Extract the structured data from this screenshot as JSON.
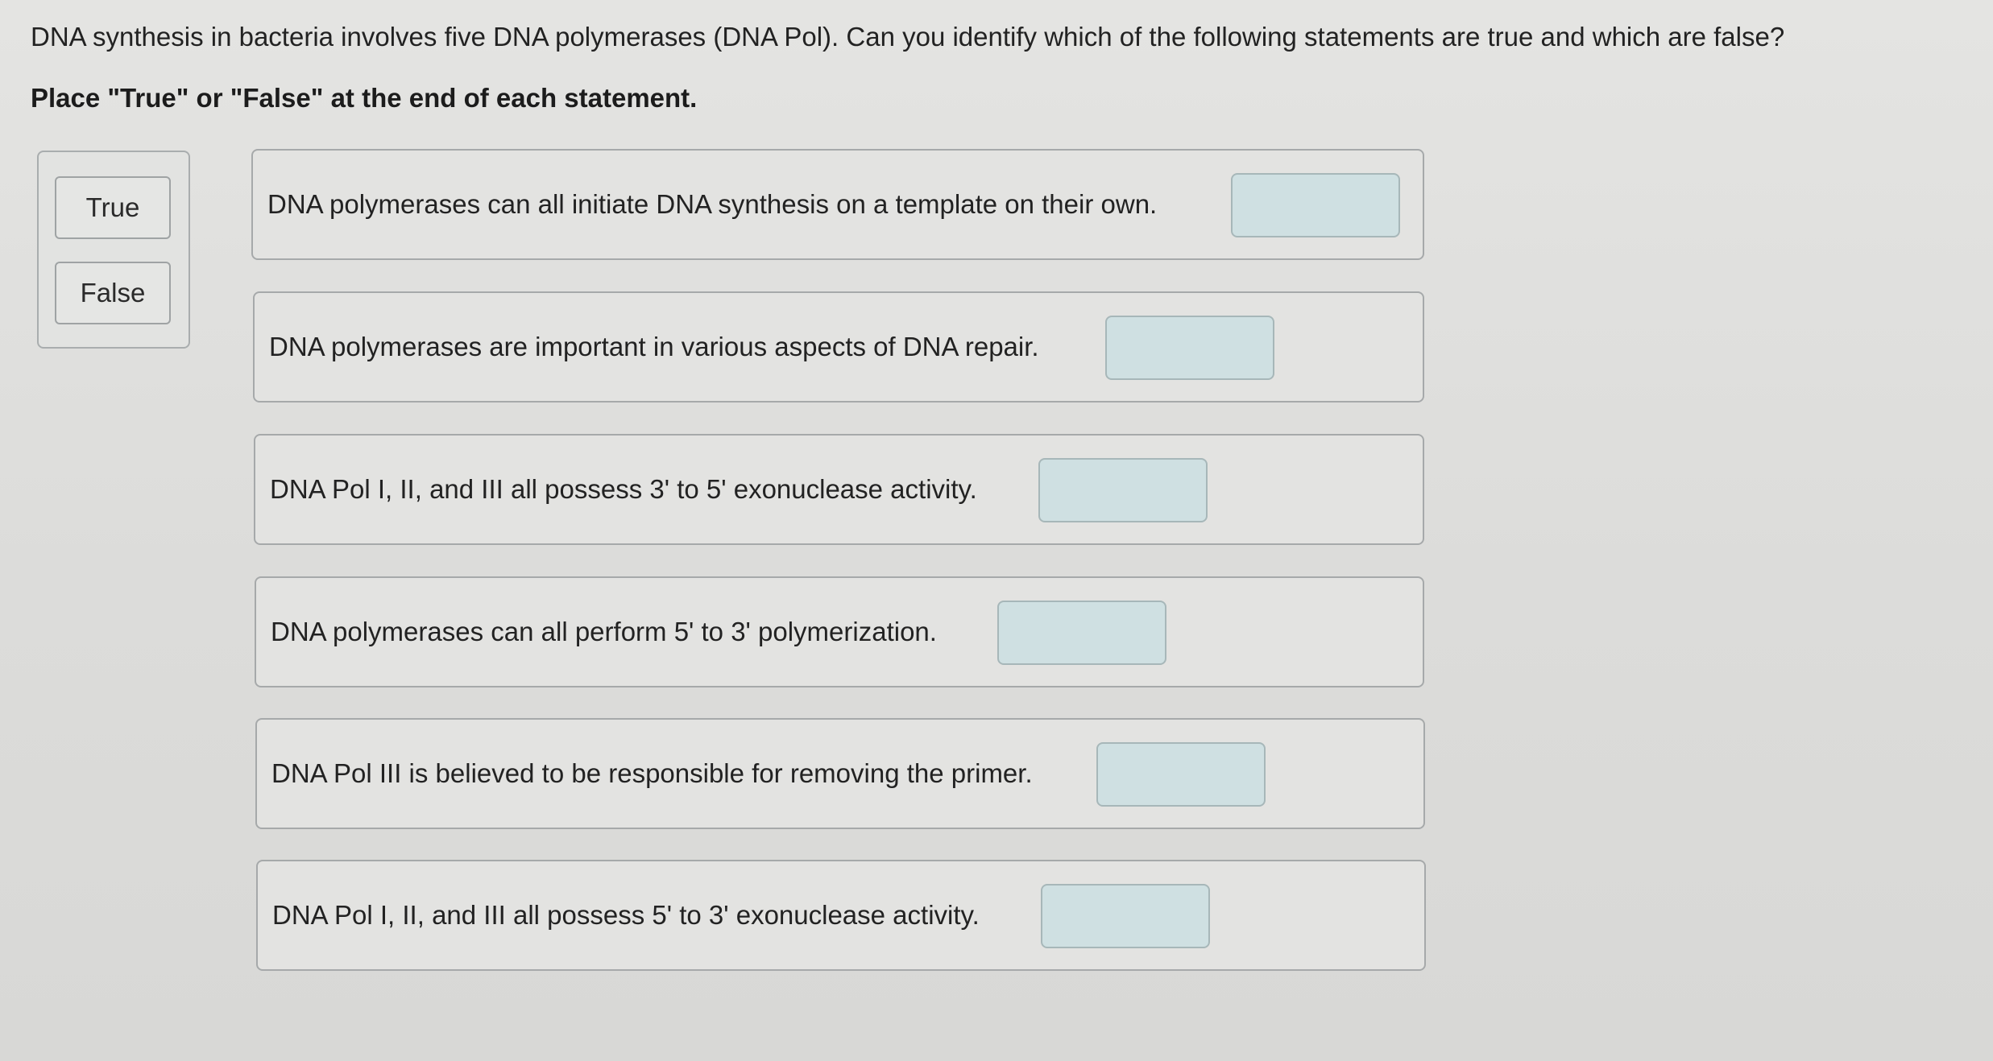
{
  "question": "DNA synthesis in bacteria involves five DNA polymerases (DNA Pol). Can you identify which of the following statements are true and which are false?",
  "instruction": "Place \"True\" or \"False\" at the end of each statement.",
  "answer_bank": {
    "true_label": "True",
    "false_label": "False"
  },
  "statements": [
    {
      "text": "DNA polymerases can all initiate DNA synthesis on a template on their own.",
      "answer": ""
    },
    {
      "text": "DNA polymerases are important in various aspects of DNA repair.",
      "answer": ""
    },
    {
      "text": "DNA Pol I, II, and III all possess 3' to 5' exonuclease activity.",
      "answer": ""
    },
    {
      "text": "DNA polymerases can all perform 5' to 3' polymerization.",
      "answer": ""
    },
    {
      "text": "DNA Pol III is believed to be responsible for removing the primer.",
      "answer": ""
    },
    {
      "text": "DNA Pol I, II, and III all possess 5' to 3' exonuclease activity.",
      "answer": ""
    }
  ],
  "colors": {
    "drop_target_fill": "#cfe0e2",
    "drop_target_border": "#a7b7b9",
    "background": "#dfdfdd"
  }
}
